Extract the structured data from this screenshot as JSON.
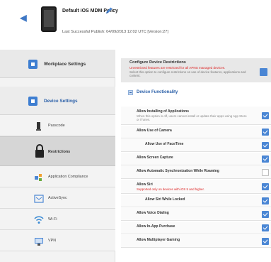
{
  "header": {
    "policy_title": "Default iOS MDM Policy",
    "publish_info": "Last Successful Publish: 04/09/2013 12:02 UTC  [Version:27]"
  },
  "sidebar": {
    "sections": [
      {
        "label": "Workplace Settings",
        "icon": "gear-icon"
      },
      {
        "label": "Device Settings",
        "icon": "device-settings-icon"
      }
    ],
    "items": [
      {
        "label": "Passcode",
        "icon": "passcode-icon",
        "active": false
      },
      {
        "label": "Restrictions",
        "icon": "lock-icon",
        "active": true
      },
      {
        "label": "Application Compliance",
        "icon": "app-compliance-icon",
        "active": false
      },
      {
        "label": "ActiveSync",
        "icon": "activesync-icon",
        "active": false
      },
      {
        "label": "Wi-Fi",
        "icon": "wifi-icon",
        "active": false
      },
      {
        "label": "VPN",
        "icon": "vpn-icon",
        "active": false
      }
    ]
  },
  "content": {
    "configure": {
      "title": "Configure Device Restrictions",
      "warning": "Unrestricted features are restricted for all APNS managed devices.",
      "description": "Select this option to configure restrictions on use of device features, applications and content.",
      "checked": true
    },
    "section_title": "Device Functionality",
    "rows": [
      {
        "title": "Allow Installing of Applications",
        "desc": "When this option is off, users cannot install or update their apps using App Store or iTunes.",
        "checked": true
      },
      {
        "title": "Allow Use of Camera",
        "checked": true
      },
      {
        "title": "Allow Use of FaceTime",
        "checked": true,
        "indent": true
      },
      {
        "title": "Allow Screen Capture",
        "checked": true
      },
      {
        "title": "Allow Automatic Synchronization While Roaming",
        "checked": false
      },
      {
        "title": "Allow Siri",
        "warn": "Supported only on devices with iOS 5 and higher.",
        "checked": true
      },
      {
        "title": "Allow Siri While Locked",
        "checked": true,
        "indent": true
      },
      {
        "title": "Allow Voice Dialing",
        "checked": true
      },
      {
        "title": "Allow In-App Purchase",
        "checked": true
      },
      {
        "title": "Allow Multiplayer Gaming",
        "checked": true
      }
    ]
  },
  "colors": {
    "accent": "#4a86d4",
    "warning": "#dd2222",
    "section_blue": "#2a5fa8"
  }
}
